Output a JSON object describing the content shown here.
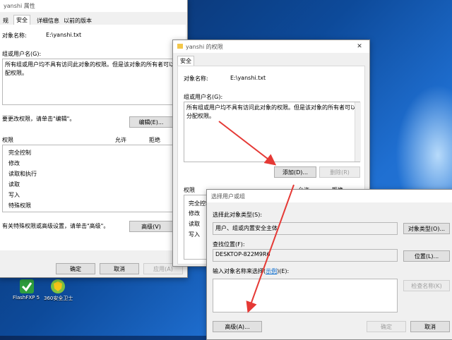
{
  "desktop": {
    "icons": [
      {
        "label": "FlashFXP 5"
      },
      {
        "label": "360安全卫士"
      }
    ]
  },
  "props_window": {
    "title": "yanshi 属性",
    "tabs": [
      "规",
      "安全",
      "详细信息",
      "以前的版本"
    ],
    "object_name_label": "对象名称:",
    "object_name_value": "E:\\yanshi.txt",
    "group_label": "组或用户名(G):",
    "group_message": "所有组或用户均不具有访问此对象的权限。但是该对象的所有者可以分配权限。",
    "change_hint": "要更改权限，请单击\"编辑\"。",
    "edit_button": "编辑(E)...",
    "perm_label": "权限",
    "allow_label": "允许",
    "deny_label": "拒绝",
    "permissions": [
      "完全控制",
      "修改",
      "读取和执行",
      "读取",
      "写入",
      "特殊权限"
    ],
    "advanced_hint": "有关特殊权限或高级设置，请单击\"高级\"。",
    "advanced_button": "高级(V)",
    "ok": "确定",
    "cancel": "取消",
    "apply": "应用(A)"
  },
  "perm_window": {
    "title": "yanshi 的权限",
    "tab": "安全",
    "object_name_label": "对象名称:",
    "object_name_value": "E:\\yanshi.txt",
    "group_label": "组或用户名(G):",
    "group_message": "所有组或用户均不具有访问此对象的权限。但是该对象的所有者可以分配权限。",
    "add_button": "添加(D)...",
    "remove_button": "删除(R)",
    "perm_label": "权限",
    "allow_label": "允许",
    "deny_label": "拒绝",
    "permissions": [
      "完全控制",
      "修改",
      "读取",
      "写入"
    ]
  },
  "select_dialog": {
    "title": "选择用户或组",
    "object_type_label": "选择此对象类型(S):",
    "object_type_value": "用户、组或内置安全主体",
    "object_type_button": "对象类型(O)...",
    "location_label": "查找位置(F):",
    "location_value": "DESKTOP-822M9R6",
    "location_button": "位置(L)...",
    "enter_label_prefix": "输入对象名称来选择(",
    "enter_label_link": "示例",
    "enter_label_suffix": ")(E):",
    "check_names_button": "检查名称(K)",
    "advanced_button": "高级(A)...",
    "ok": "确定",
    "cancel": "取消"
  },
  "colors": {
    "arrow": "#e53935",
    "link": "#0066cc"
  }
}
